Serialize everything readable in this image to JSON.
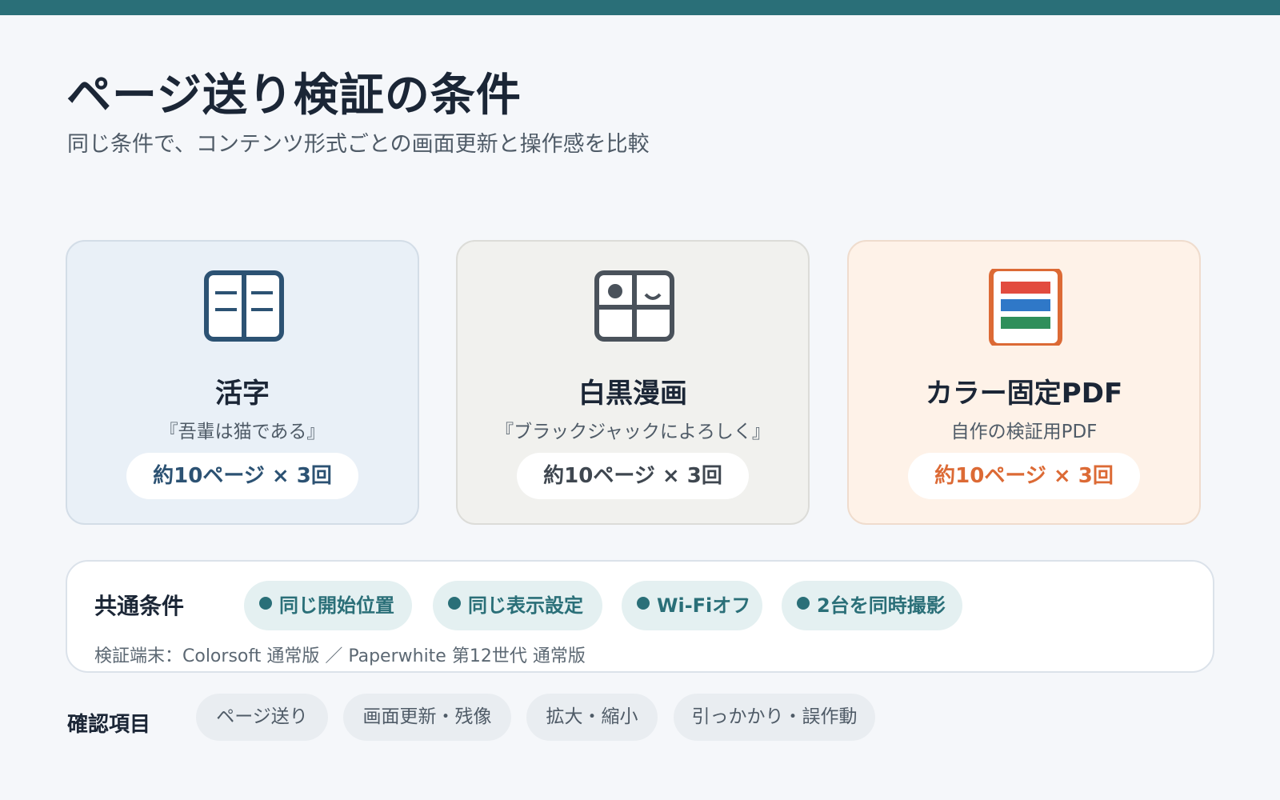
{
  "header": {
    "title": "ページ送り検証の条件",
    "subtitle": "同じ条件で、コンテンツ形式ごとの画面更新と操作感を比較"
  },
  "cards": [
    {
      "icon": "book-icon",
      "title": "活字",
      "work": "『吾輩は猫である』",
      "pages": "約10ページ × 3回",
      "color": "#2c5273"
    },
    {
      "icon": "manga-panel-icon",
      "title": "白黒漫画",
      "work": "『ブラックジャックによろしく』",
      "pages": "約10ページ × 3回",
      "color": "#3f4750"
    },
    {
      "icon": "color-document-icon",
      "title": "カラー固定PDF",
      "work": "自作の検証用PDF",
      "pages": "約10ページ × 3回",
      "color": "#dc6a35"
    }
  ],
  "common": {
    "label": "共通条件",
    "chips": [
      "同じ開始位置",
      "同じ表示設定",
      "Wi-Fiオフ",
      "2台を同時撮影"
    ],
    "devices": "検証端末：Colorsoft 通常版 ／ Paperwhite 第12世代 通常版"
  },
  "checks": {
    "label": "確認項目",
    "items": [
      "ページ送り",
      "画面更新・残像",
      "拡大・縮小",
      "引っかかり・誤作動"
    ]
  },
  "colors": {
    "accent": "#2a6f78",
    "background": "#f5f7fa",
    "pdf_red": "#e24b3f",
    "pdf_blue": "#2f78c8",
    "pdf_green": "#2f8f5b"
  }
}
